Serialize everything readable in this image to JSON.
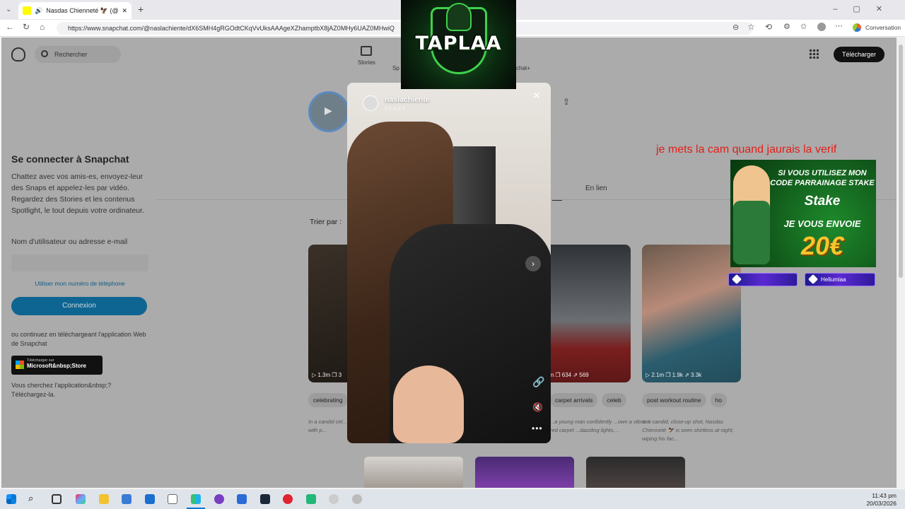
{
  "browser": {
    "tab_title": "Nasdas Chienneté 🦅 (@nasl",
    "url": "https://www.snapchat.com/@naslachiente/dX6SMH4gRGOdtCKqVvUksAAAgeXZhamptbX8jAZ0MHy6UAZ0MHwiQ",
    "profile_label": "Conversation"
  },
  "snapchat": {
    "search_placeholder": "Rechercher",
    "nav": {
      "stories": "Stories",
      "spotlight": "Sp",
      "plus": "chat+"
    },
    "download_button": "Télécharger",
    "login": {
      "title": "Se connecter à Snapchat",
      "description": "Chattez avec vos amis-es, envoyez-leur des Snaps et appelez-les par vidéo. Regardez des Stories et les contenus Spotlight, le tout depuis votre ordinateur.",
      "username_label": "Nom d'utilisateur ou adresse e-mail",
      "phone_link": "Utiliser mon numéro de téléphone",
      "connect_button": "Connexion",
      "or_app": "ou continuez en téléchargeant l'application Web de Snapchat",
      "store_small": "Télécharger sur",
      "store_big": "Microsoft&nbsp;Store",
      "looking_for": "Vous cherchez l'application&nbsp;?",
      "download_link": "Téléchargez-la."
    },
    "tab_en_lien": "En lien",
    "sort_by": "Trier par :",
    "cards": [
      {
        "stats": "▷ 1.3m  ❐ 3",
        "tags": [
          "celebrating"
        ],
        "desc": "In a candid cel... Nasdas Chienn... a victory with p..."
      },
      {
        "stats": "▷ 1.1m  ❐ 634  ⇗ 569",
        "tags": [
          "carpet arrivals",
          "celeb"
        ],
        "desc": "...a young man confidently ...own a vibrant red carpet ...dazzling lights,..."
      },
      {
        "stats": "▷ 2.1m  ❐ 1.9k  ⇗ 3.3k",
        "tags": [
          "post workout routine",
          "ho"
        ],
        "desc": "In a candid, close-up shot, Nasdas Chienneté 🦅 is seen shirtless at night, wiping his fac..."
      }
    ]
  },
  "story": {
    "username": "naslachiente",
    "time": "il y a 6 h"
  },
  "overlay": {
    "logo_text": "TAPLAA",
    "red_text": "je mets la cam quand jaurais la verif",
    "stake": {
      "line1": "SI VOUS UTILISEZ MON CODE PARRAINAGE STAKE",
      "brand": "Stake",
      "line2": "JE VOUS ENVOIE",
      "amount": "20€"
    },
    "bar2_text": "Hellumiaa"
  },
  "taskbar": {
    "time": "11:43 pm",
    "date": "20/03/2026"
  }
}
